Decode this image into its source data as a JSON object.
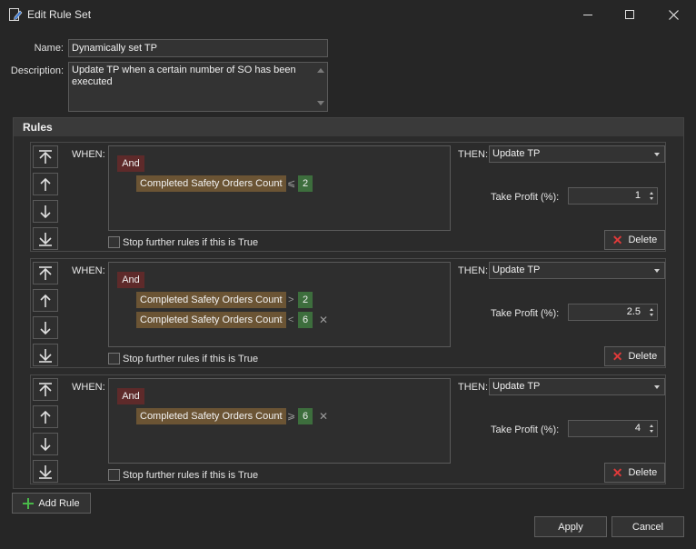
{
  "window": {
    "title": "Edit Rule Set"
  },
  "form": {
    "name_label": "Name:",
    "name_value": "Dynamically set TP",
    "description_label": "Description:",
    "description_value": "Update TP when a certain number of SO has been executed"
  },
  "rules": {
    "header": "Rules",
    "when_label": "WHEN:",
    "then_label": "THEN:",
    "stop_label": "Stop further rules if this is True",
    "tp_label": "Take Profit (%):",
    "delete_label": "Delete",
    "items": [
      {
        "group": "And",
        "conditions": [
          {
            "field": "Completed Safety Orders Count",
            "op": "⩽",
            "value": "2"
          }
        ],
        "action": "Update TP",
        "take_profit": "1"
      },
      {
        "group": "And",
        "conditions": [
          {
            "field": "Completed Safety Orders Count",
            "op": ">",
            "value": "2"
          },
          {
            "field": "Completed Safety Orders Count",
            "op": "<",
            "value": "6"
          }
        ],
        "action": "Update TP",
        "take_profit": "2.5"
      },
      {
        "group": "And",
        "conditions": [
          {
            "field": "Completed Safety Orders Count",
            "op": "⩾",
            "value": "6"
          }
        ],
        "action": "Update TP",
        "take_profit": "4"
      }
    ]
  },
  "buttons": {
    "add_rule": "Add Rule",
    "apply": "Apply",
    "cancel": "Cancel"
  },
  "icons": {
    "title": "edit-document-icon",
    "move_top": "move-top-icon",
    "move_up": "arrow-up-icon",
    "move_down": "arrow-down-icon",
    "move_bottom": "move-bottom-icon",
    "delete": "delete-x-icon",
    "add": "plus-icon"
  },
  "colors": {
    "and_chip": "#5e2a2a",
    "field_chip": "#6b5434",
    "value_chip": "#3d6e3d",
    "delete_icon": "#e03a3a",
    "add_icon": "#49b849"
  }
}
